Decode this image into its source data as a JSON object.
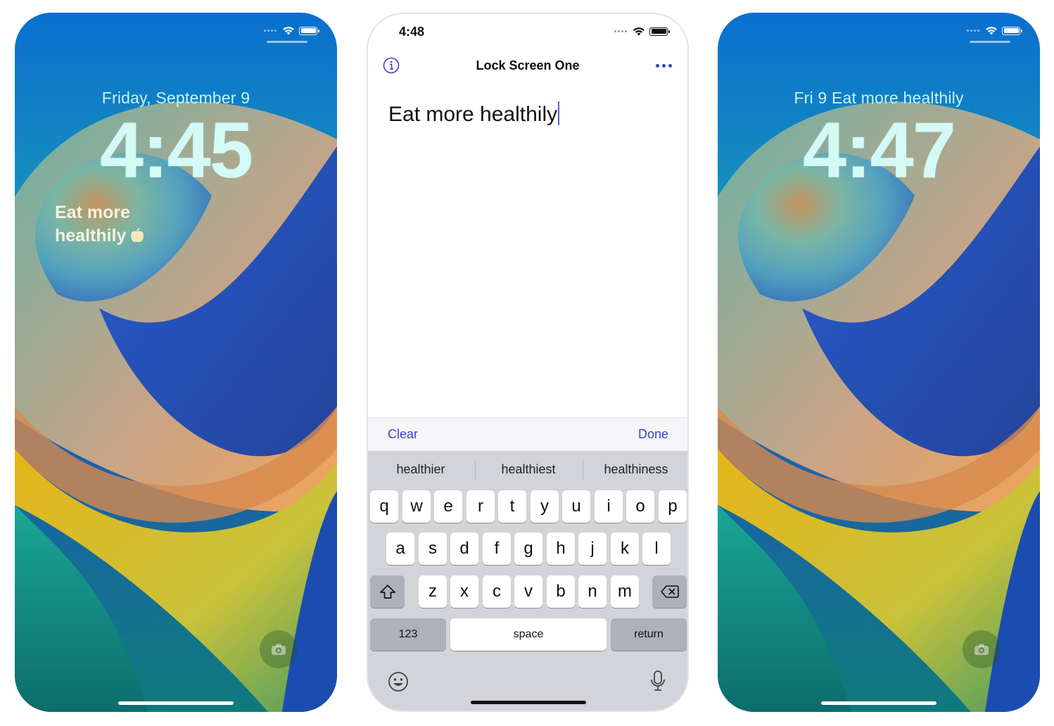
{
  "screens": {
    "left": {
      "date": "Friday, September 9",
      "time": "4:45",
      "widget_line1": "Eat more",
      "widget_line2": "healthily",
      "widget_icon": "apple-icon"
    },
    "middle": {
      "status_time": "4:48",
      "title": "Lock Screen One",
      "text": "Eat more healthily",
      "toolbar": {
        "clear": "Clear",
        "done": "Done"
      },
      "suggestions": [
        "healthier",
        "healthiest",
        "healthiness"
      ],
      "keys": {
        "row1": [
          "q",
          "w",
          "e",
          "r",
          "t",
          "y",
          "u",
          "i",
          "o",
          "p"
        ],
        "row2": [
          "a",
          "s",
          "d",
          "f",
          "g",
          "h",
          "j",
          "k",
          "l"
        ],
        "row3": [
          "z",
          "x",
          "c",
          "v",
          "b",
          "n",
          "m"
        ],
        "numbers": "123",
        "space": "space",
        "return": "return"
      }
    },
    "right": {
      "date_line": "Fri 9  Eat more healthily",
      "time": "4:47"
    }
  },
  "colors": {
    "accent": "#3b3fc8",
    "lock_text": "#d4faf6",
    "keyboard_bg": "#d2d4da"
  }
}
